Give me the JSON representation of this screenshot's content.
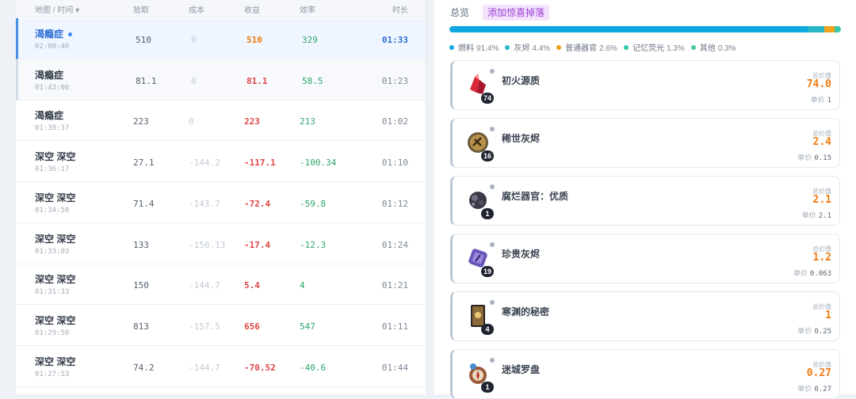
{
  "table": {
    "headers": {
      "map_time": "地图 / 时间 ▾",
      "pick": "拾取",
      "cost": "成本",
      "profit": "收益",
      "efficiency": "效率",
      "duration": "时长"
    },
    "rows": [
      {
        "map": "渴瘾症",
        "time": "02:00:40",
        "pick": "510",
        "cost": "0",
        "profit": "510",
        "profit_color": "#f07a10",
        "efficiency": "329",
        "duration": "01:33",
        "state": "selected"
      },
      {
        "map": "渴瘾症",
        "time": "01:43:00",
        "pick": "81.1",
        "cost": "0",
        "profit": "81.1",
        "profit_color": "#e14545",
        "efficiency": "58.5",
        "duration": "01:23",
        "state": "hover"
      },
      {
        "map": "渴瘾症",
        "time": "01:39:37",
        "pick": "223",
        "cost": "0",
        "profit": "223",
        "profit_color": "#e14545",
        "efficiency": "213",
        "duration": "01:02",
        "state": ""
      },
      {
        "map": "深空 深空",
        "time": "01:36:17",
        "pick": "27.1",
        "cost": "-144.2",
        "profit": "-117.1",
        "profit_color": "#e14545",
        "efficiency": "-100.34",
        "duration": "01:10",
        "state": ""
      },
      {
        "map": "深空 深空",
        "time": "01:34:58",
        "pick": "71.4",
        "cost": "-143.7",
        "profit": "-72.4",
        "profit_color": "#e14545",
        "efficiency": "-59.8",
        "duration": "01:12",
        "state": ""
      },
      {
        "map": "深空 深空",
        "time": "01:33:03",
        "pick": "133",
        "cost": "-150.13",
        "profit": "-17.4",
        "profit_color": "#e14545",
        "efficiency": "-12.3",
        "duration": "01:24",
        "state": ""
      },
      {
        "map": "深空 深空",
        "time": "01:31:33",
        "pick": "150",
        "cost": "-144.7",
        "profit": "5.4",
        "profit_color": "#e14545",
        "efficiency": "4",
        "duration": "01:21",
        "state": ""
      },
      {
        "map": "深空 深空",
        "time": "01:29:50",
        "pick": "813",
        "cost": "-157.5",
        "profit": "656",
        "profit_color": "#e14545",
        "efficiency": "547",
        "duration": "01:11",
        "state": ""
      },
      {
        "map": "深空 深空",
        "time": "01:27:53",
        "pick": "74.2",
        "cost": "-144.7",
        "profit": "-70.52",
        "profit_color": "#e14545",
        "efficiency": "-40.6",
        "duration": "01:44",
        "state": ""
      }
    ]
  },
  "summary": {
    "tabs": [
      "总览",
      "添加惊喜掉落"
    ],
    "breakdown": [
      {
        "label": "燃料",
        "pct": "91.4%",
        "value": 91.4,
        "color": "#10a7e0"
      },
      {
        "label": "灰烬",
        "pct": "4.4%",
        "value": 4.4,
        "color": "#26b6c7"
      },
      {
        "label": "普通器官",
        "pct": "2.6%",
        "value": 2.6,
        "color": "#f0a21a"
      },
      {
        "label": "记忆荧光",
        "pct": "1.3%",
        "value": 1.3,
        "color": "#35c7a9"
      },
      {
        "label": "其他",
        "pct": "0.3%",
        "value": 0.3,
        "color": "#4cc7a0"
      }
    ],
    "total_label": "总价值",
    "unit_label": "单价",
    "items": [
      {
        "name": "初火源质",
        "count": "74",
        "total": "74.0",
        "unit": "1",
        "icon": "red-crystal-icon",
        "color": "#d9283a"
      },
      {
        "name": "稀世灰烬",
        "count": "16",
        "total": "2.4",
        "unit": "0.15",
        "icon": "gold-medallion-icon",
        "color": "#b8914a"
      },
      {
        "name": "腐烂器官：优质",
        "count": "1",
        "total": "2.1",
        "unit": "2.1",
        "icon": "dark-orb-icon",
        "color": "#3b3a46"
      },
      {
        "name": "珍贵灰烬",
        "count": "19",
        "total": "1.2",
        "unit": "0.063",
        "icon": "purple-rune-icon",
        "color": "#6a55b8"
      },
      {
        "name": "寒渊的秘密",
        "count": "4",
        "total": "1",
        "unit": "0.25",
        "icon": "card-icon",
        "color": "#8a6a3a"
      },
      {
        "name": "迷城罗盘",
        "count": "1",
        "total": "0.27",
        "unit": "0.27",
        "icon": "compass-icon",
        "color": "#9a5a38"
      }
    ]
  }
}
